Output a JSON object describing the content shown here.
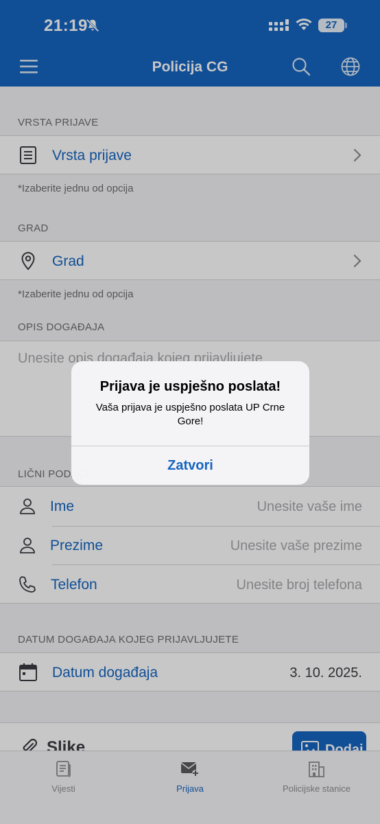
{
  "status_bar": {
    "time": "21:19",
    "battery": "27"
  },
  "header": {
    "title": "Policija CG"
  },
  "sections": {
    "report_type": {
      "label": "VRSTA PRIJAVE",
      "field": "Vrsta prijave",
      "hint": "*Izaberite jednu od opcija"
    },
    "city": {
      "label": "GRAD",
      "field": "Grad",
      "hint": "*Izaberite jednu od opcija"
    },
    "description": {
      "label": "OPIS DOGAĐAJA",
      "placeholder": "Unesite opis događaja kojeg prijavljujete"
    },
    "personal": {
      "label": "LIČNI PODACI",
      "fields": [
        {
          "label": "Ime",
          "placeholder": "Unesite vaše ime"
        },
        {
          "label": "Prezime",
          "placeholder": "Unesite vaše prezime"
        },
        {
          "label": "Telefon",
          "placeholder": "Unesite broj telefona"
        }
      ]
    },
    "date": {
      "label": "DATUM DOGAĐAJA KOJEG PRIJAVLJUJETE",
      "field": "Datum događaja",
      "value": "3. 10. 2025."
    },
    "images": {
      "label": "Slike",
      "add_label": "Dodaj"
    }
  },
  "tabs": [
    {
      "label": "Vijesti",
      "icon": "news-icon",
      "active": false
    },
    {
      "label": "Prijava",
      "icon": "report-icon",
      "active": true
    },
    {
      "label": "Policijske stanice",
      "icon": "building-icon",
      "active": false
    }
  ],
  "alert": {
    "title": "Prijava je uspješno poslata!",
    "message": "Vaša prijava je uspješno poslata UP Crne Gore!",
    "button": "Zatvori"
  },
  "colors": {
    "accent": "#1565c0",
    "background": "#f2f2f7",
    "secondary_text": "#6d6d72",
    "placeholder": "#a8a8ad"
  }
}
